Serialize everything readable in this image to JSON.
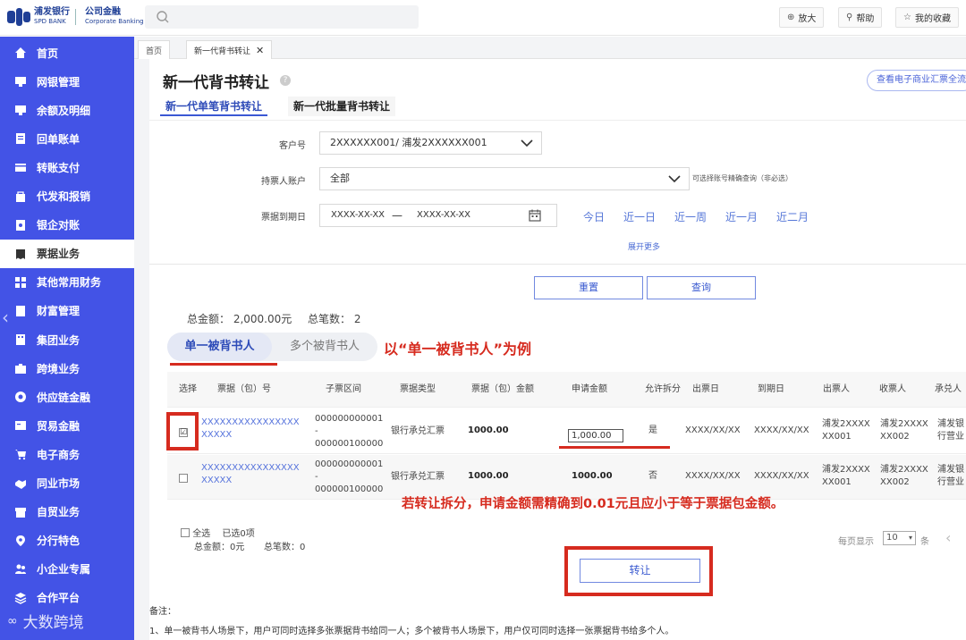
{
  "logo": {
    "cn": "浦发银行",
    "en": "SPD BANK",
    "corp_cn": "公司金融",
    "corp_en": "Corporate Banking"
  },
  "topbar": {
    "zoom": "放大",
    "help": "帮助",
    "favorites": "我的收藏"
  },
  "sidebar": {
    "items": [
      {
        "label": "首页",
        "icon": "home-icon"
      },
      {
        "label": "网银管理",
        "icon": "monitor-icon"
      },
      {
        "label": "余额及明细",
        "icon": "monitor-icon"
      },
      {
        "label": "回单账单",
        "icon": "receipt-icon"
      },
      {
        "label": "转账支付",
        "icon": "card-icon"
      },
      {
        "label": "代发和报销",
        "icon": "bag-icon"
      },
      {
        "label": "银企对账",
        "icon": "ledger-icon"
      },
      {
        "label": "票据业务",
        "icon": "bill-icon"
      },
      {
        "label": "其他常用财务",
        "icon": "grid-icon"
      },
      {
        "label": "财富管理",
        "icon": "wealth-icon"
      },
      {
        "label": "集团业务",
        "icon": "building-icon"
      },
      {
        "label": "跨境业务",
        "icon": "briefcase-icon"
      },
      {
        "label": "供应链金融",
        "icon": "chain-icon"
      },
      {
        "label": "贸易金融",
        "icon": "trade-icon"
      },
      {
        "label": "电子商务",
        "icon": "cart-icon"
      },
      {
        "label": "同业市场",
        "icon": "handshake-icon"
      },
      {
        "label": "自贸业务",
        "icon": "store-icon"
      },
      {
        "label": "分行特色",
        "icon": "pin-icon"
      },
      {
        "label": "小企业专属",
        "icon": "people-icon"
      },
      {
        "label": "合作平台",
        "icon": "stack-icon"
      }
    ],
    "active_index": 7
  },
  "watermark": "大数跨境",
  "tabs": {
    "home": "首页",
    "current": "新一代背书转让"
  },
  "page": {
    "title": "新一代背书转让",
    "help_mark": "?",
    "top_link": "查看电子商业汇票全流",
    "subtabs": [
      "新一代单笔背书转让",
      "新一代批量背书转让"
    ]
  },
  "filters": {
    "customer_label": "客户号",
    "customer_value": "2XXXXXX001/ 浦发2XXXXXX001",
    "holder_label": "持票人账户",
    "holder_value": "全部",
    "holder_hint": "可选择账号精确查询（非必选）",
    "date_label": "票据到期日",
    "date_start": "XXXX-XX-XX",
    "date_sep": "—",
    "date_end": "XXXX-XX-XX",
    "quick": [
      "今日",
      "近一日",
      "近一周",
      "近一月",
      "近二月"
    ],
    "expand": "展开更多",
    "reset": "重置",
    "query": "查询"
  },
  "summary": {
    "total_amount": "总金额： 2,000.00元",
    "total_count": "总笔数： 2"
  },
  "endorsee_tabs": {
    "single": "单一被背书人",
    "multiple": "多个被背书人"
  },
  "annotation_single": "以“单一被背书人”为例",
  "annotation_amount": "若转让拆分，申请金额需精确到0.01元且应小于等于票据包金额。",
  "table": {
    "headers": [
      "选择",
      "票据（包）号",
      "子票区间",
      "票据类型",
      "票据（包）金额",
      "申请金额",
      "允许拆分",
      "出票日",
      "到期日",
      "出票人",
      "收票人",
      "承兑人"
    ],
    "rows": [
      {
        "checked": "☑",
        "no1": "XXXXXXXXXXXXXXXX",
        "no2": "XXXXX",
        "range1": "000000000001",
        "range2": "-",
        "range3": "000000100000",
        "type": "银行承兑汇票",
        "amount": "1000.00",
        "apply": "1,000.00",
        "split": "是",
        "issue": "XXXX/XX/XX",
        "due": "XXXX/XX/XX",
        "drawer1": "浦发2XXXX",
        "drawer2": "XX001",
        "payee1": "浦发2XXXX",
        "payee2": "XX002",
        "acceptor1": "浦发银",
        "acceptor2": "行营业"
      },
      {
        "checked": "",
        "no1": "XXXXXXXXXXXXXXXX",
        "no2": "XXXXX",
        "range1": "000000000001",
        "range2": "-",
        "range3": "000000100000",
        "type": "银行承兑汇票",
        "amount": "1000.00",
        "apply": "1000.00",
        "split": "否",
        "issue": "XXXX/XX/XX",
        "due": "XXXX/XX/XX",
        "drawer1": "浦发2XXXX",
        "drawer2": "XX001",
        "payee1": "浦发2XXXX",
        "payee2": "XX002",
        "acceptor1": "浦发银",
        "acceptor2": "行营业"
      }
    ]
  },
  "footer": {
    "select_all": "全选",
    "selected": "已选0项",
    "sel_amount": "总金额：0元",
    "sel_count": "总笔数：0",
    "per_page_label": "每页显示",
    "per_page_value": "10",
    "per_page_unit": "条",
    "transfer": "转让"
  },
  "remarks": {
    "title": "备注：",
    "line1": "1、单一被背书人场景下，用户可同时选择多张票据背书给同一人；多个被背书人场景下，用户仅可同时选择一张票据背书给多个人。"
  }
}
